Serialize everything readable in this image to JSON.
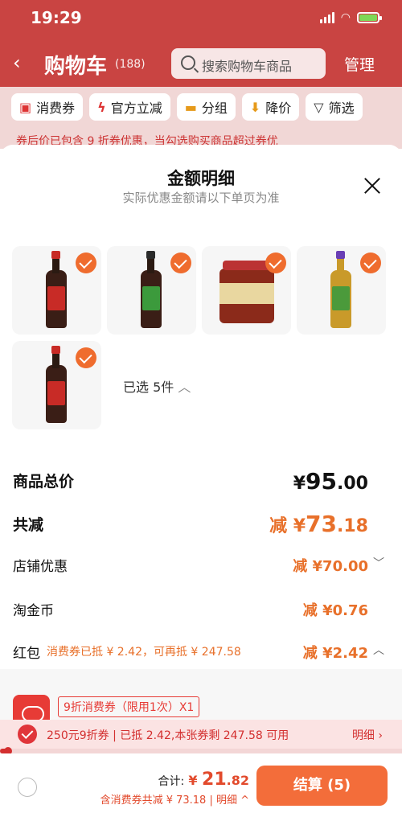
{
  "status_bar": {
    "time": "19:29"
  },
  "header": {
    "title": "购物车",
    "count": "(188)",
    "search_placeholder": "搜索购物车商品",
    "manage": "管理"
  },
  "filters": [
    {
      "label": "消费券",
      "icon": "coupon-icon"
    },
    {
      "label": "官方立减",
      "icon": "lightning-icon"
    },
    {
      "label": "分组",
      "icon": "folder-icon"
    },
    {
      "label": "降价",
      "icon": "down-arrow-icon"
    },
    {
      "label": "筛选",
      "icon": "filter-icon"
    }
  ],
  "notice": "券后价已包含 9 折券优惠，当勾选购买商品超过券优",
  "sheet": {
    "title": "金额明细",
    "subtitle": "实际优惠金额请以下单页为准",
    "selected": "已选 5件",
    "rows": {
      "total": {
        "label": "商品总价",
        "currency": "¥",
        "int": "95",
        "dec": ".00"
      },
      "reduce": {
        "label": "共减",
        "prefix": "减 ¥",
        "int": "73",
        "dec": ".18"
      },
      "shop": {
        "label": "店铺优惠",
        "value": "减 ¥70.00"
      },
      "coin": {
        "label": "淘金币",
        "value": "减 ¥0.76"
      },
      "redpack": {
        "label": "红包",
        "note": "消费券已抵 ¥ 2.42，可再抵 ¥ 247.58",
        "value": "减 ¥2.42"
      }
    },
    "coupon_tag": "9折消费券（限用1次）X1"
  },
  "promo": {
    "text": "250元9折券 | 已抵 2.42,本张券剩 247.58 可用",
    "detail": "明细 ›",
    "progress": 0.02
  },
  "bottom": {
    "sum_label": "合计:",
    "sum_currency": "¥",
    "sum_int": "21",
    "sum_dec": ".82",
    "sum_sub": "含消费券共减 ¥ 73.18 | 明细 ^",
    "checkout": "结算 (5)"
  },
  "colors": {
    "brand_red": "#c94442",
    "accent_orange": "#f36d3a",
    "discount_orange": "#e8702a"
  }
}
